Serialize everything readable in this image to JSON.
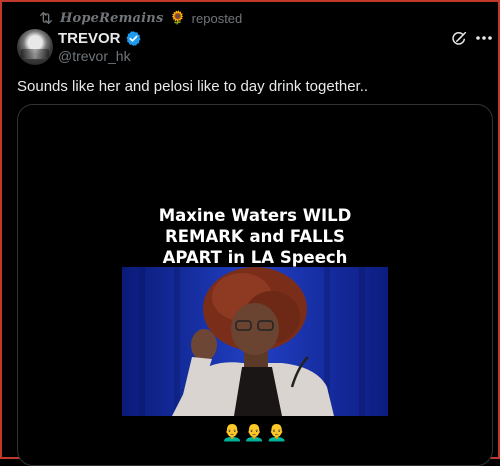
{
  "repost": {
    "icon": "repost-icon",
    "reposter_name": "𝑯𝒐𝒑𝒆𝑹𝒆𝒎𝒂𝒊𝒏𝒔",
    "reposter_emoji": "🌻",
    "label": "reposted"
  },
  "author": {
    "display_name": "TREVOR",
    "handle": "@trevor_hk",
    "verified": true,
    "verified_color": "#1d9bf0"
  },
  "header_actions": {
    "grok_icon": "grok-icon",
    "more_icon": "more-options-icon"
  },
  "tweet": {
    "text": "Sounds like her and pelosi like to day drink together.."
  },
  "media": {
    "title_lines": [
      "Maxine Waters WILD",
      "REMARK and FALLS",
      "APART in LA Speech"
    ],
    "caption_emojis": "👨‍🦲👨‍🦲👨‍🦲"
  },
  "colors": {
    "background": "#000000",
    "text_primary": "#e7e9ea",
    "text_secondary": "#71767b",
    "border": "#2f3336",
    "accent_blue": "#1d9bf0"
  }
}
